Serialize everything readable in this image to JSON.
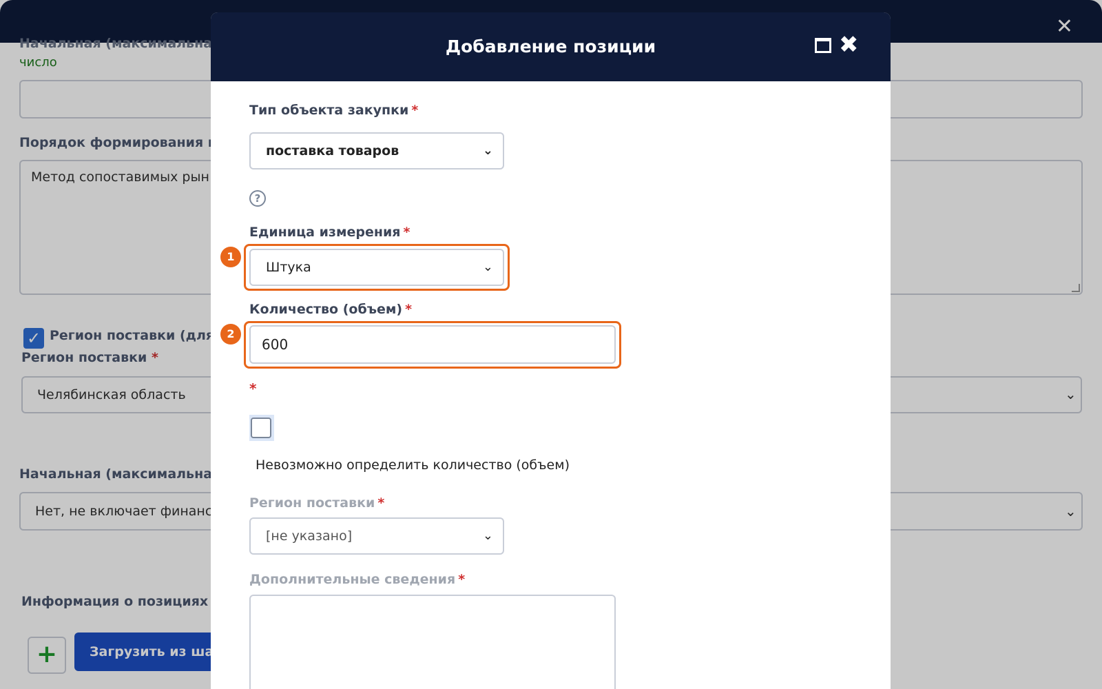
{
  "background": {
    "top_partial_label": "Начальная (максимальная)",
    "number_hint": "число",
    "pricing_method_label": "Порядок формирования це",
    "pricing_method_value": "Метод сопоставимых рын",
    "delivery_region_checkbox_label": "Регион поставки (для г",
    "delivery_region_label": "Регион поставки",
    "delivery_region_required": "*",
    "delivery_region_value": "Челябинская область",
    "nmck_label": "Начальная (максимальная)",
    "nmck_value": "Нет, не включает финансо",
    "positions_info_label": "Информация о позициях т",
    "load_template_button": "Загрузить из шаб",
    "close_symbol": "✕",
    "check_symbol": "✓",
    "plus_symbol": "+"
  },
  "modal": {
    "title": "Добавление позиции",
    "close_symbol": "✖",
    "required_mark": "*",
    "purchase_object_type": {
      "label": "Тип объекта закупки",
      "value": "поставка товаров"
    },
    "help_symbol": "?",
    "unit": {
      "label": "Единица измерения",
      "value": "Штука",
      "badge": "1"
    },
    "quantity": {
      "label": "Количество (объем)",
      "value": "600",
      "badge": "2"
    },
    "indeterminate_quantity": {
      "label": "Невозможно определить количество (объем)",
      "checked": false
    },
    "delivery_region": {
      "label": "Регион поставки",
      "value": "[не указано]"
    },
    "additional_info": {
      "label": "Дополнительные сведения",
      "value": ""
    },
    "chevron_symbol": "⌄"
  },
  "colors": {
    "header_bg": "#0f1b3a",
    "highlight": "#e8661a",
    "required": "#d03030",
    "primary_button": "#1d4fc4",
    "hint_green": "#1f7a1f"
  }
}
